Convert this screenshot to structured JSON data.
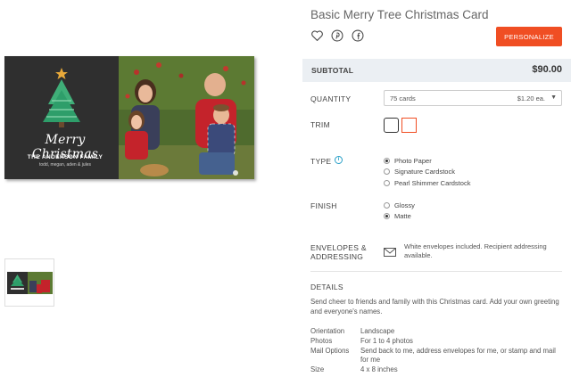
{
  "product": {
    "title": "Basic Merry Tree Christmas Card",
    "personalize_label": "PERSONALIZE"
  },
  "share": {
    "icons": [
      "heart-icon",
      "pinterest-icon",
      "facebook-icon"
    ]
  },
  "card": {
    "greeting": "Merry Christmas",
    "family_name": "THE ANDERSON FAMILY",
    "members": "todd, megan, aden & jules"
  },
  "subtotal": {
    "label": "SUBTOTAL",
    "value": "$90.00"
  },
  "quantity": {
    "label": "QUANTITY",
    "selected": "75 cards",
    "price_each": "$1.20 ea."
  },
  "trim": {
    "label": "TRIM",
    "options": [
      "rounded",
      "square"
    ],
    "selected": "square"
  },
  "type": {
    "label": "TYPE",
    "options": [
      "Photo Paper",
      "Signature Cardstock",
      "Pearl Shimmer Cardstock"
    ],
    "selected": "Photo Paper"
  },
  "finish": {
    "label": "FINISH",
    "options": [
      "Glossy",
      "Matte"
    ],
    "selected": "Matte"
  },
  "envelopes": {
    "label_line1": "ENVELOPES &",
    "label_line2": "ADDRESSING",
    "text": "White envelopes included. Recipient addressing available."
  },
  "details": {
    "heading": "DETAILS",
    "description": "Send cheer to friends and family with this Christmas card. Add your own greeting and everyone's names.",
    "specs": [
      {
        "label": "Orientation",
        "value": "Landscape"
      },
      {
        "label": "Photos",
        "value": "For 1 to 4 photos"
      },
      {
        "label": "Mail Options",
        "value": "Send back to me, address envelopes for me, or stamp and mail for me"
      },
      {
        "label": "Size",
        "value": "4 x 8 inches"
      }
    ]
  },
  "colors": {
    "accent": "#f04e23",
    "subtotal_bg": "#ebeff3",
    "info_blue": "#2aa0c8",
    "card_bg": "#2f2f2f",
    "tree_green": "#2e9e6a"
  }
}
